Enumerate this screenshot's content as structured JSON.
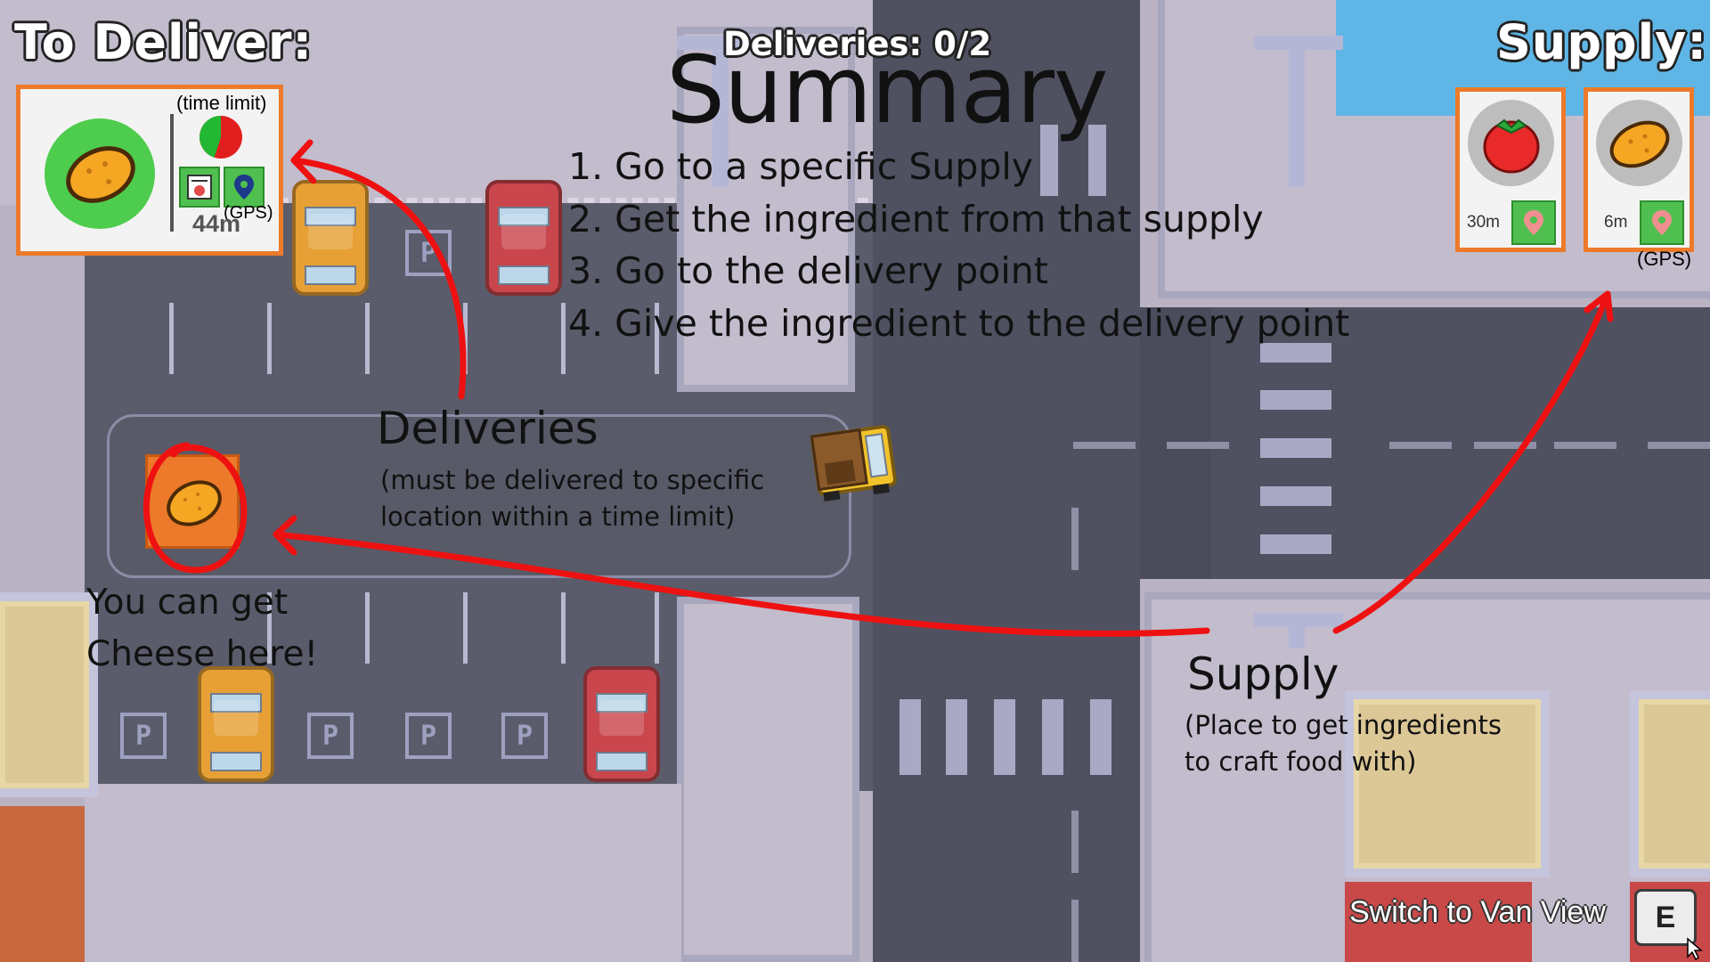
{
  "hud": {
    "to_deliver_title": "To Deliver:",
    "deliveries_counter": "Deliveries: 0/2",
    "supply_title": "Supply:",
    "order": {
      "item_icon": "potato-icon",
      "time_limit_label": "(time limit)",
      "gps_label": "(GPS)",
      "distance": "44m",
      "timer_fraction_remaining": 0.45
    },
    "supplies": [
      {
        "item_icon": "tomato-icon",
        "distance": "30m"
      },
      {
        "item_icon": "potato-icon",
        "distance": "6m"
      }
    ],
    "supply_gps_label": "(GPS)",
    "switch_view_label": "Switch to Van View",
    "switch_view_key": "E"
  },
  "tutorial": {
    "title": "Summary",
    "steps": [
      "1. Go to a specific Supply",
      "2. Get the ingredient from that supply",
      "3. Go to the delivery point",
      "4. Give the ingredient to the delivery point"
    ],
    "deliveries_heading": "Deliveries",
    "deliveries_desc_line1": "(must be delivered to specific",
    "deliveries_desc_line2": "location within a time limit)",
    "cheese_line1": "You can get",
    "cheese_line2": "Cheese here!",
    "supply_heading": "Supply",
    "supply_desc_line1": "(Place to get ingredients",
    "supply_desc_line2": "to craft food with)"
  },
  "colors": {
    "accent_orange": "#ec7a2a",
    "annotation_red": "#ee1111",
    "gps_green": "#4fc04f",
    "timer_green": "#22b833",
    "timer_red": "#e21f1f"
  }
}
